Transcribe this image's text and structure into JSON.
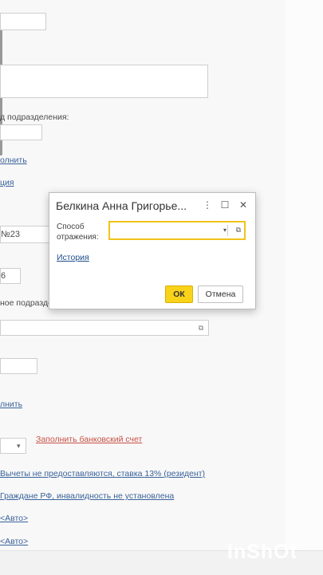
{
  "background": {
    "subdivision_label": "д подразделения:",
    "fill_link_1": "олнить",
    "link_tsiya": "ция",
    "field_no23": "№23",
    "field_6": "6",
    "subdivision_label_2": "ное подразде",
    "fill_link_2": "лнить",
    "fill_bank_account": "Заполнить банковский счет",
    "deductions_link": "Вычеты не предоставляются, ставка 13% (резидент)",
    "citizen_link": "Граждане РФ, инвалидность не установлена",
    "auto_link_1": "<Авто>",
    "auto_link_2": "<Авто>"
  },
  "dialog": {
    "title": "Белкина Анна Григорье...",
    "menu_icon": "more-vert-icon",
    "maximize_icon": "maximize-icon",
    "close_icon": "close-icon",
    "field_label": "Способ отражения:",
    "field_value": "",
    "history_link": "История",
    "ok_button": "ОК",
    "cancel_button": "Отмена"
  },
  "colors": {
    "accent": "#f9d21a",
    "link": "#1f4d8c",
    "red_link": "#c0392b"
  },
  "watermark": "InShOt"
}
